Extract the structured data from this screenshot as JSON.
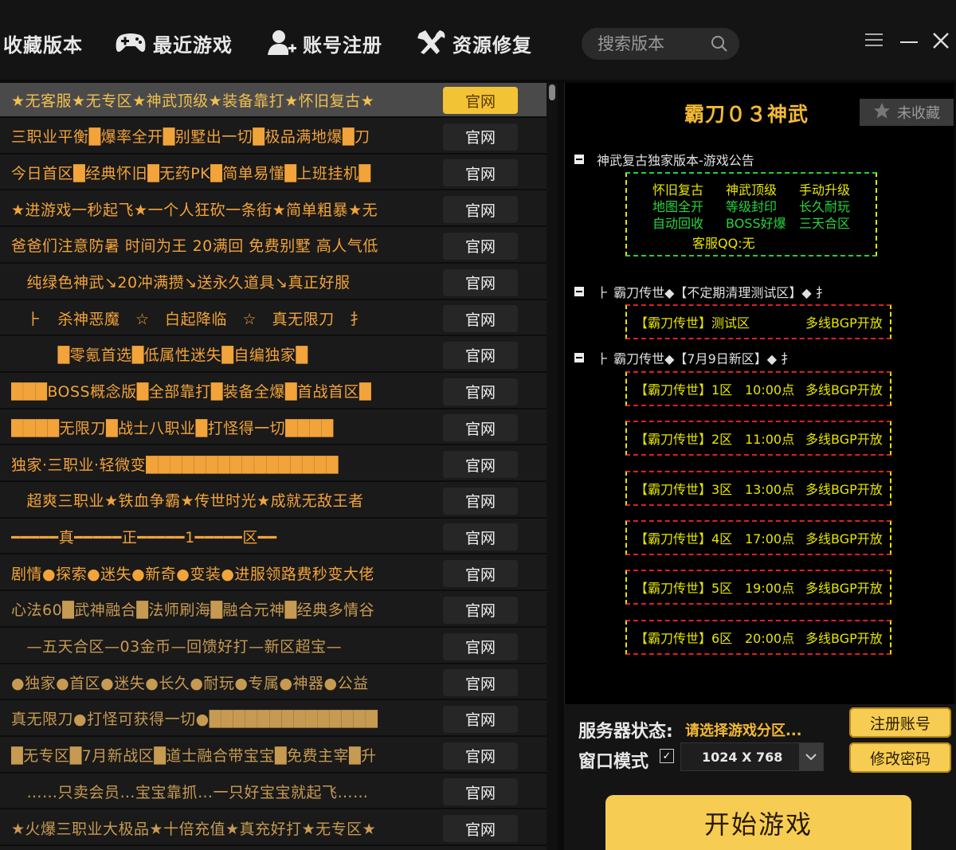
{
  "nav": {
    "items": [
      {
        "label": "收藏版本",
        "icon": "none"
      },
      {
        "label": "最近游戏",
        "icon": "gamepad-icon"
      },
      {
        "label": "账号注册",
        "icon": "user-add-icon"
      },
      {
        "label": "资源修复",
        "icon": "tools-icon"
      }
    ],
    "search_placeholder": "搜索版本"
  },
  "list": {
    "button_label": "官网",
    "rows": [
      {
        "name": "★无客服★无专区★神武顶级★装备靠打★怀旧复古★",
        "selected": true
      },
      {
        "name": "三职业平衡█爆率全开█别墅出一切█极品满地爆█刀"
      },
      {
        "name": "今日首区█经典怀旧█无药PK█简单易懂█上班挂机█"
      },
      {
        "name": "★进游戏一秒起飞★一个人狂砍一条街★简单粗暴★无"
      },
      {
        "name": "爸爸们注意防暑 时间为王 20满回 免费别墅 高人气低"
      },
      {
        "name": "　纯绿色神武↘20冲满攒↘送永久道具↘真正好服"
      },
      {
        "name": "　⺊　杀神恶魔　☆　白起降临　☆　真无限刀　⺘"
      },
      {
        "name": "　　　█零氪首选█低属性迷失█自编独家█"
      },
      {
        "name": "███BOSS概念版█全部靠打█装备全爆█首战首区█"
      },
      {
        "name": "████无限刀█战士八职业█打怪得一切████"
      },
      {
        "name": "独家·三职业·轻微变████████████████"
      },
      {
        "name": "　超爽三职业★铁血争霸★传世时光★成就无敌王者"
      },
      {
        "name": "━━━━━真━━━━━正━━━━━1━━━━━区━━"
      },
      {
        "name": "剧情●探索●迷失●新奇●变装●进服领路费秒变大佬"
      },
      {
        "name": "心法60█武神融合█法师刷海█融合元神█经典多情谷",
        "dim": true
      },
      {
        "name": "　—五天合区—03金币—回馈好打—新区超宝—",
        "dim": true
      },
      {
        "name": "●独家●首区●迷失●长久●耐玩●专属●神器●公益",
        "dim": true
      },
      {
        "name": "真无限刀●打怪可获得一切●██████████████",
        "dim": true
      },
      {
        "name": "█无专区█7月新战区█道士融合带宝宝█免费主宰█升",
        "dim": true
      },
      {
        "name": "　……只卖会员…宝宝靠抓…一只好宝宝就起飞……",
        "dim": true
      },
      {
        "name": "★火爆三职业大极品★十倍充值★真充好打★无专区★",
        "dim": true
      }
    ]
  },
  "detail": {
    "title": "霸刀０３神武",
    "fav_label": "未收藏",
    "notice_heading": "神武复古独家版本-游戏公告",
    "notice_cells": [
      {
        "text": "怀旧复古",
        "color": "#e6e600"
      },
      {
        "text": "神武顶级",
        "color": "#e6e600"
      },
      {
        "text": "手动升级",
        "color": "#e6e600"
      },
      {
        "text": "地图全开",
        "color": "#28d43e"
      },
      {
        "text": "等级封印",
        "color": "#28d43e"
      },
      {
        "text": "长久耐玩",
        "color": "#28d43e"
      },
      {
        "text": "自动回收",
        "color": "#28d43e"
      },
      {
        "text": "BOSS好爆",
        "color": "#28d43e"
      },
      {
        "text": "三天合区",
        "color": "#28d43e"
      }
    ],
    "notice_qq": "客服QQ:无",
    "group1_heading": "⺊ 霸刀传世◆【不定期清理测试区】◆ ⺘",
    "group1_servers": [
      {
        "name": "【霸刀传世】测试区",
        "time": "",
        "open": "多线BGP开放"
      }
    ],
    "group2_heading": "⺊ 霸刀传世◆【7月9日新区】◆ ⺘",
    "group2_servers": [
      {
        "name": "【霸刀传世】1区",
        "time": "10:00点",
        "open": "多线BGP开放"
      },
      {
        "name": "【霸刀传世】2区",
        "time": "11:00点",
        "open": "多线BGP开放"
      },
      {
        "name": "【霸刀传世】3区",
        "time": "13:00点",
        "open": "多线BGP开放"
      },
      {
        "name": "【霸刀传世】4区",
        "time": "17:00点",
        "open": "多线BGP开放"
      },
      {
        "name": "【霸刀传世】5区",
        "time": "19:00点",
        "open": "多线BGP开放"
      },
      {
        "name": "【霸刀传世】6区",
        "time": "20:00点",
        "open": "多线BGP开放"
      }
    ]
  },
  "bottom": {
    "status_label": "服务器状态:",
    "status_value": "请选择游戏分区...",
    "window_label": "窗口模式",
    "window_checked": "✓",
    "resolution": "1024 X 768",
    "register_label": "注册账号",
    "password_label": "修改密码",
    "start_label": "开始游戏"
  },
  "colors": {
    "accent": "#f6cd52",
    "list_text": "#f2a33a",
    "notice_yellow": "#e6e600",
    "notice_green": "#28d43e",
    "server_border": "#e02020"
  }
}
